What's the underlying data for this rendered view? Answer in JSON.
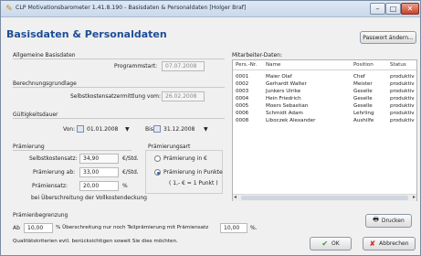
{
  "window": {
    "title": "CLP Motivationsbarometer 1.41.8.190 - Basisdaten & Personaldaten   [Holger Braf]",
    "min_symbol": "–",
    "max_symbol": "□",
    "close_symbol": "✕"
  },
  "heading": "Basisdaten & Personaldaten",
  "password_button": "Passwort ändern...",
  "basisdaten": {
    "section_label": "Allgemeine Basisdaten",
    "programmstart_label": "Programmstart:",
    "programmstart_value": "07.07.2008"
  },
  "berechnung": {
    "section_label": "Berechnungsgrundlage",
    "ermittlung_label": "Selbstkostensatzermittlung vom:",
    "ermittlung_value": "26.02.2008"
  },
  "gueltigkeit": {
    "section_label": "Gültigkeitsdauer",
    "von_label": "Von:",
    "von_value": "01.01.2008",
    "bis_label": "Bis:",
    "bis_value": "31.12.2008"
  },
  "praemierung": {
    "section_label": "Prämierung",
    "selbstkostensatz_label": "Selbstkostensatz:",
    "selbstkostensatz_value": "34,90",
    "selbstkostensatz_unit": "€/Std.",
    "praemierung_ab_label": "Prämierung ab:",
    "praemierung_ab_value": "33,00",
    "praemierung_ab_unit": "€/Std.",
    "praemiensatz_label": "Prämiensatz:",
    "praemiensatz_value": "20,00",
    "praemiensatz_unit": "%",
    "note": "bei Überschreitung der Vollkostendeckung"
  },
  "praemierungsart": {
    "label": "Prämierungsart",
    "option_euro": "Prämierung in €",
    "option_punkte": "Prämierung in Punkte",
    "punkte_note": "( 1,- € = 1 Punkt )",
    "selected": "punkte"
  },
  "mitarbeiter": {
    "label": "Mitarbeiter-Daten:",
    "columns": [
      "Pers.-Nr.",
      "Name",
      "Position",
      "Status"
    ],
    "rows": [
      [
        "0001",
        "Maier Olaf",
        "Chef",
        "produktiv"
      ],
      [
        "0002",
        "Gerhardt Walter",
        "Meister",
        "produktiv"
      ],
      [
        "0003",
        "Junkers Ulrike",
        "Geselle",
        "produktiv"
      ],
      [
        "0004",
        "Hein Friedrich",
        "Geselle",
        "produktiv"
      ],
      [
        "0005",
        "Moers Sebastian",
        "Geselle",
        "produktiv"
      ],
      [
        "0006",
        "Schmidt Adam",
        "Lehrling",
        "produktiv"
      ],
      [
        "0008",
        "Liboczek Alexander",
        "Aushilfe",
        "produktiv"
      ]
    ]
  },
  "begrenzung": {
    "section_label": "Prämienbegrenzung",
    "ab_label": "Ab",
    "ab_value": "10,00",
    "middle_text": "% Überschreitung nur noch Teilprämierung mit Prämiensatz",
    "satz_value": "10,00",
    "percent": "%.",
    "note": "Qualitätskriterien evtl. berücksichtigen soweit Sie dies möchten."
  },
  "buttons": {
    "drucken": "Drucken",
    "ok": "OK",
    "abbrechen": "Abbrechen"
  },
  "colors": {
    "heading": "#1d4d96",
    "ok_icon": "#2f9a2f",
    "cancel_icon": "#c8281c"
  }
}
